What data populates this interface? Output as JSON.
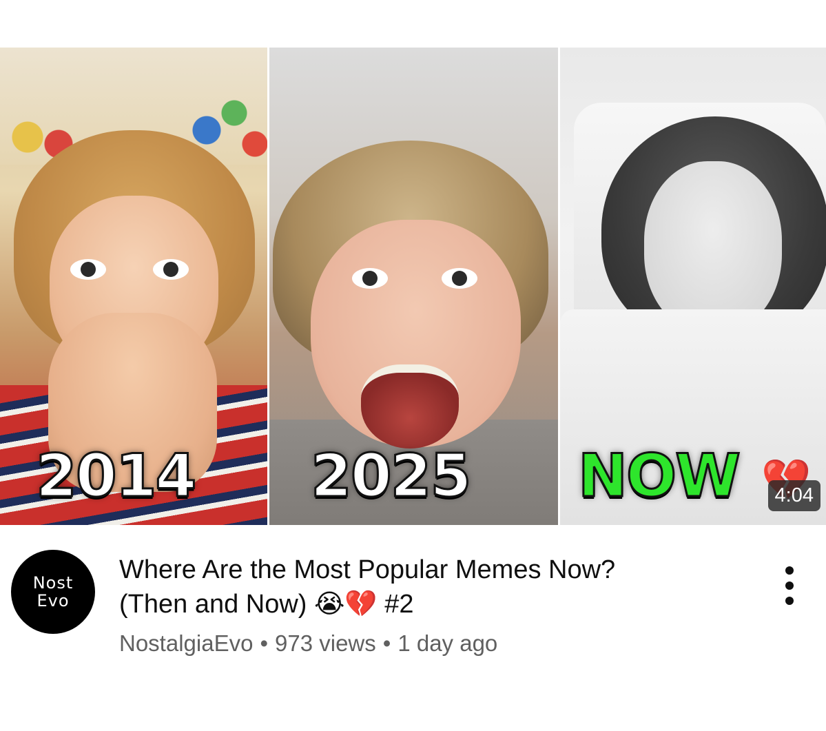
{
  "thumbnail": {
    "label_1": "2014",
    "label_2": "2025",
    "label_3": "NOW",
    "label_3_color": "#2ee52c",
    "label_3_emoji": "💔",
    "duration": "4:04"
  },
  "channel": {
    "avatar_line_1": "Nost",
    "avatar_line_2": "Evo",
    "name": "NostalgiaEvo"
  },
  "video": {
    "title_line_1": "Where Are the Most Popular Memes Now?",
    "title_line_2": "(Then and Now) 😭💔 #2",
    "views": "973 views",
    "age": "1 day ago",
    "separator": "•"
  },
  "menu": {
    "icon": "more-vert-icon"
  }
}
